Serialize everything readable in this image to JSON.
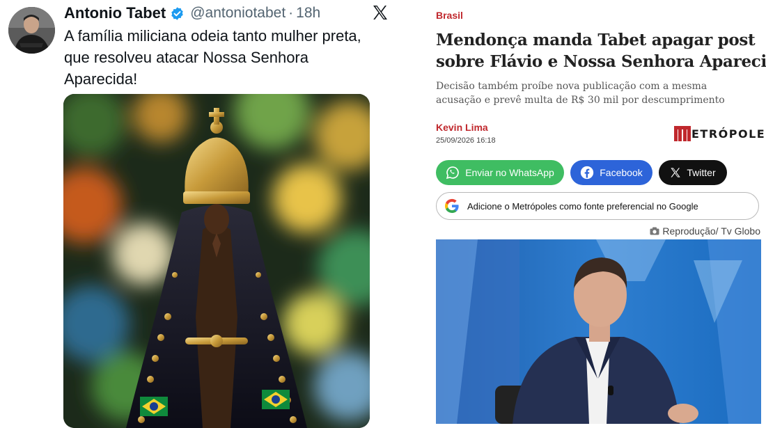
{
  "tweet": {
    "author_name": "Antonio Tabet",
    "handle": "@antoniotabet",
    "separator": "·",
    "time": "18h",
    "text_lines": [
      "A família miliciana odeia tanto mulher preta,",
      "que resolveu atacar Nossa Senhora",
      "Aparecida!"
    ],
    "icons": {
      "verified": "verified-badge-icon",
      "platform": "x-logo-icon"
    }
  },
  "article": {
    "section": "Brasil",
    "headline_lines": [
      "Mendonça manda Tabet apagar post",
      "sobre Flávio e Nossa Senhora Aparecida"
    ],
    "subhead_lines": [
      "Decisão também proíbe nova publicação com a mesma",
      "acusação e prevê multa de R$ 30 mil por descumprimento"
    ],
    "author": "Kevin Lima",
    "date": "25/09/2026 16:18",
    "brand": "ETRÓPOLES",
    "share": {
      "whatsapp": "Enviar no WhatsApp",
      "facebook": "Facebook",
      "twitter": "Twitter"
    },
    "google_source": "Adicione o Metrópoles como fonte preferencial no Google",
    "photo_credit": "Reprodução/ Tv Globo"
  },
  "colors": {
    "accent_red": "#c0282d",
    "whatsapp_green": "#3fbd62",
    "facebook_blue": "#2d64d9",
    "twitter_black": "#111111",
    "verified_blue": "#1d9bf0"
  }
}
